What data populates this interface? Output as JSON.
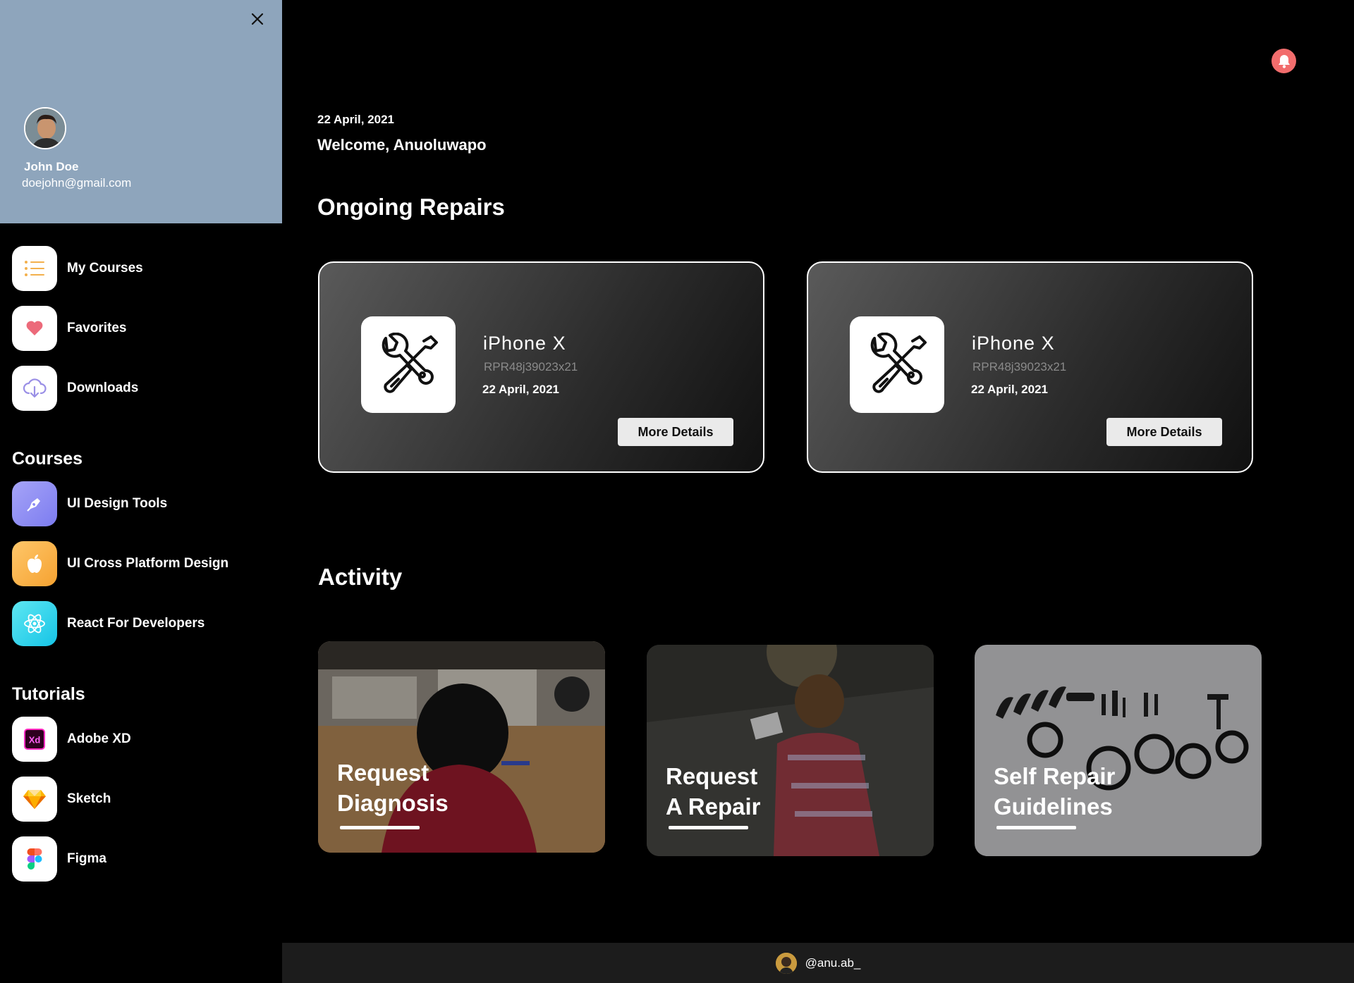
{
  "profile": {
    "name": "John Doe",
    "email": "doejohn@gmail.com"
  },
  "nav": {
    "primary": [
      {
        "label": "My Courses",
        "icon": "list-icon"
      },
      {
        "label": "Favorites",
        "icon": "heart-icon"
      },
      {
        "label": "Downloads",
        "icon": "cloud-download-icon"
      }
    ],
    "courses_heading": "Courses",
    "courses": [
      {
        "label": "UI Design Tools",
        "icon": "pen-tool-icon"
      },
      {
        "label": "UI Cross Platform Design",
        "icon": "apple-icon"
      },
      {
        "label": "React For Developers",
        "icon": "react-icon"
      }
    ],
    "tutorials_heading": "Tutorials",
    "tutorials": [
      {
        "label": "Adobe XD",
        "icon": "adobe-xd-icon"
      },
      {
        "label": "Sketch",
        "icon": "sketch-icon"
      },
      {
        "label": "Figma",
        "icon": "figma-icon"
      }
    ]
  },
  "header": {
    "date": "22 April, 2021",
    "welcome": "Welcome, Anuoluwapo"
  },
  "ongoing": {
    "heading": "Ongoing Repairs",
    "cards": [
      {
        "device": "iPhone X",
        "code": "RPR48j39023x21",
        "date": "22 April, 2021",
        "button": "More Details"
      },
      {
        "device": "iPhone X",
        "code": "RPR48j39023x21",
        "date": "22 April, 2021",
        "button": "More Details"
      }
    ]
  },
  "activity": {
    "heading": "Activity",
    "cards": [
      {
        "line1": "Request",
        "line2": "Diagnosis"
      },
      {
        "line1": "Request",
        "line2": "A Repair"
      },
      {
        "line1": "Self Repair",
        "line2": "Guidelines"
      }
    ]
  },
  "footer": {
    "handle": "@anu.ab_"
  },
  "colors": {
    "profile_bg": "#8ea5bc",
    "bell": "#f26d6d",
    "card_border": "#ffffff",
    "button_bg": "#eaeaea"
  }
}
